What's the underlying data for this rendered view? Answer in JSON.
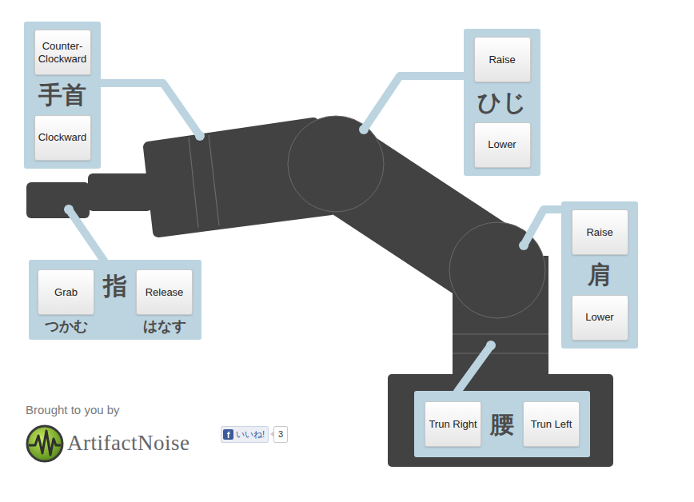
{
  "panels": {
    "wrist": {
      "label": "手首",
      "buttons": [
        "Counter-Clockward",
        "Clockward"
      ]
    },
    "elbow": {
      "label": "ひじ",
      "buttons": [
        "Raise",
        "Lower"
      ]
    },
    "shoulder": {
      "label": "肩",
      "buttons": [
        "Raise",
        "Lower"
      ]
    },
    "finger": {
      "label": "指",
      "buttons": [
        "Grab",
        "Release"
      ],
      "sublabels": [
        "つかむ",
        "はなす"
      ]
    },
    "waist": {
      "label": "腰",
      "buttons": [
        "Trun Right",
        "Trun Left"
      ]
    }
  },
  "credit": {
    "text": "Brought to you by",
    "logo": "ArtifactNoise"
  },
  "like": {
    "icon": "f",
    "label": "いいね!",
    "count": "3"
  }
}
